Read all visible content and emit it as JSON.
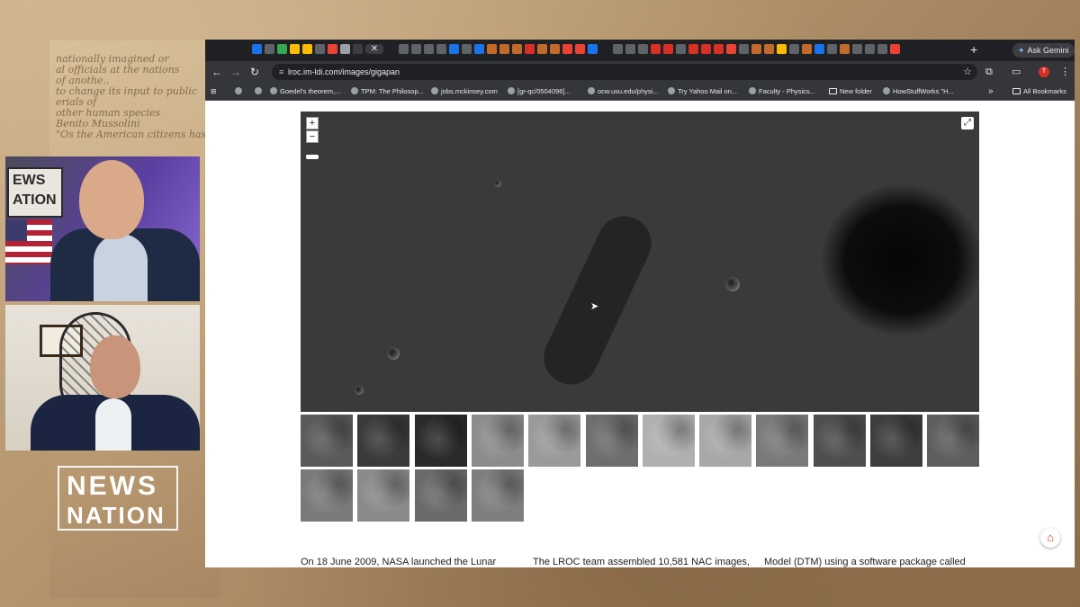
{
  "background_text": {
    "lines": [
      "",
      "",
      "nationally imagined or",
      "al officials at the nations",
      "of anothe..",
      "to change its input to public",
      "erials of",
      "other human species",
      "Benito Mussolini",
      "\"Os the American citizens has"
    ]
  },
  "news_logo": {
    "line1": "NEWS",
    "line2": "NATION"
  },
  "studio_sign": {
    "line1": "EWS",
    "line2": "ATION"
  },
  "browser": {
    "tabstrip": {
      "tab_colors": [
        "#1a73e8",
        "#5f6368",
        "#34a853",
        "#fbbc04",
        "#fbbc04",
        "#5f6368",
        "#ea4335",
        "#9aa0a6",
        "#3c3d40",
        "#202124",
        "#5f6368",
        "#5f6368",
        "#5f6368",
        "#5f6368",
        "#1a73e8",
        "#5f6368",
        "#1a73e8",
        "#c26a2b",
        "#c26a2b",
        "#c26a2b",
        "#d93025",
        "#c26a2b",
        "#c26a2b",
        "#ea4335",
        "#ea4335",
        "#1a73e8",
        "#202124",
        "#5f6368",
        "#5f6368",
        "#5f6368",
        "#d93025",
        "#d93025",
        "#5f6368",
        "#d93025",
        "#d93025",
        "#d93025",
        "#ea4335",
        "#5f6368",
        "#c26a2b",
        "#c26a2b",
        "#fbbc04",
        "#5f6368",
        "#c26a2b",
        "#1a73e8",
        "#5f6368",
        "#c26a2b",
        "#5f6368",
        "#5f6368",
        "#5f6368",
        "#ea4335"
      ],
      "active_tab_close": "✕",
      "new_tab": "+",
      "ask_gemini": "Ask Gemini"
    },
    "toolbar": {
      "back": "←",
      "forward": "→",
      "reload": "↻",
      "url": "lroc.im-ldi.com/images/gigapan",
      "bookmark_star": "☆",
      "extensions": "⧉",
      "profile_initial": "T",
      "menu": "⋮"
    },
    "bookmarks": {
      "items": [
        {
          "label": "Goedel's theorem,...",
          "icon": "globe-icon"
        },
        {
          "label": "TPM: The Philosop...",
          "icon": "globe-icon"
        },
        {
          "label": "jobs.mckinsey.com",
          "icon": "globe-icon"
        },
        {
          "label": "[gr-qc/0504096]...",
          "icon": "globe-icon"
        },
        {
          "label": "ocw.usu.edu/physi...",
          "icon": "globe-icon"
        },
        {
          "label": "Try Yahoo Mail on...",
          "icon": "globe-icon"
        },
        {
          "label": "Faculty - Physics...",
          "icon": "globe-icon"
        },
        {
          "label": "New folder",
          "icon": "folder-icon"
        },
        {
          "label": "HowStuffWorks \"H...",
          "icon": "globe-icon"
        }
      ],
      "more": "»",
      "all_bookmarks": "All Bookmarks"
    }
  },
  "viewer": {
    "zoom_in": "+",
    "zoom_out": "−",
    "fullscreen": "⤢"
  },
  "thumbnails": {
    "row1": [
      {
        "name": "crater-ring",
        "bg": "#5a5a5a"
      },
      {
        "name": "small-crater",
        "bg": "#3a3a3a"
      },
      {
        "name": "dark-slope",
        "bg": "#2a2a2a"
      },
      {
        "name": "smooth-plain",
        "bg": "#8c8c8c"
      },
      {
        "name": "light-plain",
        "bg": "#9a9a9a"
      },
      {
        "name": "gray-terrain",
        "bg": "#6e6e6e"
      },
      {
        "name": "bright-crater",
        "bg": "#b0b0b0"
      },
      {
        "name": "bowl-crater",
        "bg": "#a8a8a8"
      },
      {
        "name": "dark-pit",
        "bg": "#7a7a7a"
      },
      {
        "name": "shadowed-ridge",
        "bg": "#4e4e4e"
      },
      {
        "name": "dark-terrain",
        "bg": "#3e3e3e"
      },
      {
        "name": "rough-terrain",
        "bg": "#5e5e5e"
      }
    ],
    "row2": [
      {
        "name": "mottled-terrain",
        "bg": "#7a7a7a"
      },
      {
        "name": "gradient-terrain",
        "bg": "#8a8a8a"
      },
      {
        "name": "flat-terrain",
        "bg": "#6a6a6a"
      },
      {
        "name": "textured-terrain",
        "bg": "#7e7e7e"
      }
    ]
  },
  "article": {
    "col1": "On 18 June 2009, NASA launched the Lunar",
    "col2": "The LROC team assembled 10,581 NAC images,",
    "col3": "Model (DTM) using a software package called"
  },
  "pdf_button": "⏚"
}
